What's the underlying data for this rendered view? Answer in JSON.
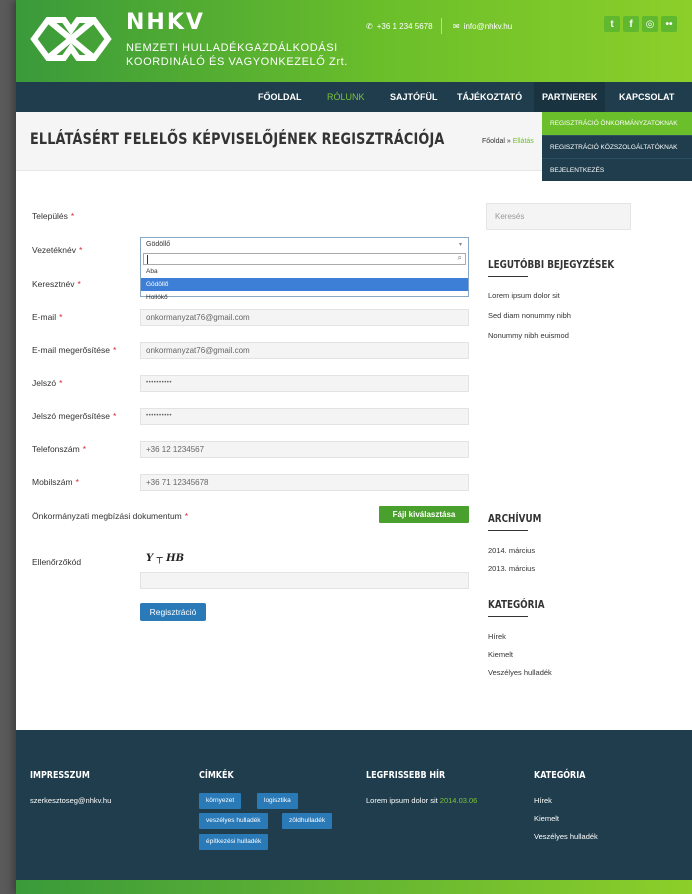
{
  "header": {
    "brand_name": "NHKV",
    "brand_line1": "NEMZETI HULLADÉKGAZDÁLKODÁSI",
    "brand_line2": "KOORDINÁLÓ ÉS VAGYONKEZELŐ Zrt.",
    "phone": "+36 1 234 5678",
    "email": "info@nhkv.hu",
    "social": [
      "twitter-icon",
      "facebook-icon",
      "dribbble-icon",
      "flickr-icon"
    ],
    "colors": {
      "green": "#6bbf2a",
      "navy": "#1f3d4c",
      "blue": "#2a7ab8"
    }
  },
  "nav": {
    "items": [
      "FŐOLDAL",
      "RÓLUNK",
      "SAJTÓFÜL",
      "TÁJÉKOZTATÓ",
      "PARTNEREK",
      "KAPCSOLAT"
    ],
    "active": "RÓLUNK",
    "dropdown": [
      "REGISZTRÁCIÓ ÖNKORMÁNYZATOKNAK",
      "REGISZTRÁCIÓ KÖZSZOLGÁLTATÓKNAK",
      "BEJELENTKEZÉS"
    ]
  },
  "titlebar": {
    "title": "ELLÁTÁSÉRT FELELŐS KÉPVISELŐJÉNEK REGISZTRÁCIÓJA",
    "crumb_home": "Főoldal",
    "crumb_sep": " » ",
    "crumb_current": "Ellátás"
  },
  "form": {
    "fields": [
      {
        "label": "Település",
        "value": ""
      },
      {
        "label": "Vezetéknév",
        "value": ""
      },
      {
        "label": "Keresztnév",
        "value": ""
      },
      {
        "label": "E-mail",
        "value": "onkormanyzat76@gmail.com"
      },
      {
        "label": "E-mail megerősítése",
        "value": "onkormanyzat76@gmail.com"
      },
      {
        "label": "Jelszó",
        "value": "••••••••••"
      },
      {
        "label": "Jelszó megerősítése",
        "value": "••••••••••"
      },
      {
        "label": "Telefonszám",
        "value": "+36 12 1234567"
      },
      {
        "label": "Mobilszám",
        "value": "+36 71 12345678"
      },
      {
        "label": "Önkormányzati megbízási dokumentum",
        "value": ""
      },
      {
        "label": "Ellenőrzőkód",
        "value": ""
      }
    ],
    "required_mark": "*",
    "select": {
      "selected": "Gödöllő",
      "search_value": "",
      "options": [
        "Aba",
        "Gödöllő",
        "Hollókő"
      ],
      "highlighted": "Gödöllő"
    },
    "file_button": "Fájl kiválasztása",
    "captcha_text": "Y ┬ HB",
    "submit": "Regisztráció"
  },
  "sidebar": {
    "search_placeholder": "Keresés",
    "recent_title": "LEGUTÓBBI BEJEGYZÉSEK",
    "recent": [
      "Lorem ipsum dolor sit",
      "Sed diam nonummy nibh",
      "Nonummy nibh euismod"
    ],
    "archive_title": "ARCHÍVUM",
    "archive": [
      "2014. március",
      "2013. március"
    ],
    "category_title": "KATEGÓRIA",
    "categories": [
      "Hírek",
      "Kiemelt",
      "Veszélyes hulladék"
    ]
  },
  "footer": {
    "impresszum_title": "IMPRESSZUM",
    "impresszum_email": "szerkesztoseg@nhkv.hu",
    "tags_title": "CÍMKÉK",
    "tags": [
      "környezet",
      "logisztika",
      "veszélyes hulladék",
      "zöldhulladék",
      "építkezési hulladék"
    ],
    "latest_title": "LEGFRISSEBB HÍR",
    "latest_text": "Lorem ipsum dolor sit",
    "latest_date": "2014.03.06",
    "category_title": "KATEGÓRIA",
    "categories": [
      "Hírek",
      "Kiemelt",
      "Veszélyes hulladék"
    ]
  }
}
